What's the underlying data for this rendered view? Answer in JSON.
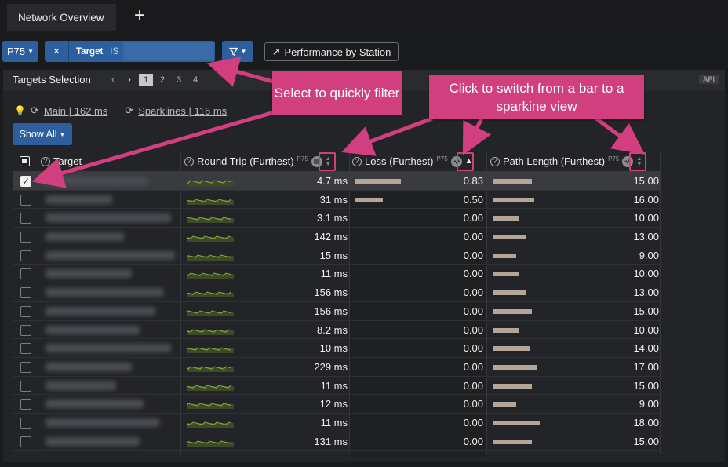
{
  "tabbar": {
    "tab_label": "Network Overview",
    "add_glyph": "+"
  },
  "toolbar": {
    "percentile_label": "P75",
    "filter_remove_glyph": "×",
    "filter_key": "Target",
    "filter_operator": "IS",
    "funnel_icon": "filter-icon",
    "perf_label": "Performance by Station",
    "perf_icon": "arrow-up-right-icon"
  },
  "panel": {
    "title": "Targets Selection",
    "pages": [
      "1",
      "2",
      "3",
      "4"
    ],
    "active_page": "1",
    "api_badge": "API",
    "main_timing": "Main | 162 ms",
    "spark_timing": "Sparklines | 116 ms",
    "show_all_label": "Show All"
  },
  "table": {
    "headers": {
      "target": "Target",
      "round_trip": "Round Trip (Furthest)",
      "loss": "Loss (Furthest)",
      "path_length": "Path Length (Furthest)",
      "percentile": "P75"
    },
    "rows": [
      {
        "rt": "4.7 ms",
        "loss": "0.83",
        "loss_frac": 0.83,
        "pl": "15.00",
        "pl_num": 15,
        "checked": true
      },
      {
        "rt": "31 ms",
        "loss": "0.50",
        "loss_frac": 0.5,
        "pl": "16.00",
        "pl_num": 16,
        "checked": false
      },
      {
        "rt": "3.1 ms",
        "loss": "0.00",
        "loss_frac": 0,
        "pl": "10.00",
        "pl_num": 10,
        "checked": false
      },
      {
        "rt": "142 ms",
        "loss": "0.00",
        "loss_frac": 0,
        "pl": "13.00",
        "pl_num": 13,
        "checked": false
      },
      {
        "rt": "15 ms",
        "loss": "0.00",
        "loss_frac": 0,
        "pl": "9.00",
        "pl_num": 9,
        "checked": false
      },
      {
        "rt": "11 ms",
        "loss": "0.00",
        "loss_frac": 0,
        "pl": "10.00",
        "pl_num": 10,
        "checked": false
      },
      {
        "rt": "156 ms",
        "loss": "0.00",
        "loss_frac": 0,
        "pl": "13.00",
        "pl_num": 13,
        "checked": false
      },
      {
        "rt": "156 ms",
        "loss": "0.00",
        "loss_frac": 0,
        "pl": "15.00",
        "pl_num": 15,
        "checked": false
      },
      {
        "rt": "8.2 ms",
        "loss": "0.00",
        "loss_frac": 0,
        "pl": "10.00",
        "pl_num": 10,
        "checked": false
      },
      {
        "rt": "10 ms",
        "loss": "0.00",
        "loss_frac": 0,
        "pl": "14.00",
        "pl_num": 14,
        "checked": false
      },
      {
        "rt": "229 ms",
        "loss": "0.00",
        "loss_frac": 0,
        "pl": "17.00",
        "pl_num": 17,
        "checked": false
      },
      {
        "rt": "11 ms",
        "loss": "0.00",
        "loss_frac": 0,
        "pl": "15.00",
        "pl_num": 15,
        "checked": false
      },
      {
        "rt": "12 ms",
        "loss": "0.00",
        "loss_frac": 0,
        "pl": "9.00",
        "pl_num": 9,
        "checked": false
      },
      {
        "rt": "11 ms",
        "loss": "0.00",
        "loss_frac": 0,
        "pl": "18.00",
        "pl_num": 18,
        "checked": false
      },
      {
        "rt": "131 ms",
        "loss": "0.00",
        "loss_frac": 0,
        "pl": "15.00",
        "pl_num": 15,
        "checked": false
      }
    ]
  },
  "annotations": {
    "filter_callout": "Select to quickly filter",
    "sparkline_callout": "Click to switch from a bar to a sparkine view"
  },
  "colors": {
    "accent": "#2d5f9e",
    "annotation": "#d13f7f",
    "bar": "#b3a597",
    "sparkline": "#8fb33a"
  }
}
